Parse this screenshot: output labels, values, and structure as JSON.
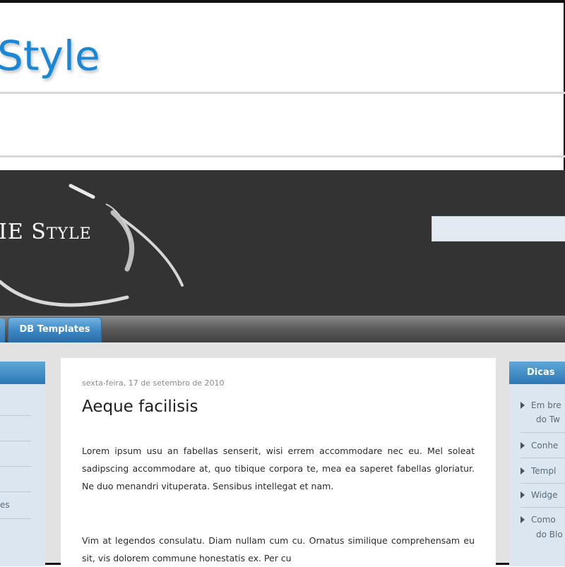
{
  "header": {
    "site_title": "Style"
  },
  "banner": {
    "title_main": "E S",
    "title_small_a": "",
    "title_tail": "TYLE"
  },
  "nav": {
    "tabs": [
      {
        "label": "DB Templates"
      }
    ]
  },
  "left_sidebar": {
    "partial_text": "es"
  },
  "post": {
    "date": "sexta-feira, 17 de setembro de 2010",
    "title": "Aeque facilisis",
    "paragraph1": "Lorem ipsum usu an fabellas senserit, wisi errem accommodare nec eu. Mel soleat sadipscing accommodare at, quo tibique corpora te, mea ea saperet fabellas gloriatur. Ne duo menandri vituperata. Sensibus intellegat et nam.",
    "paragraph2": "Vim at legendos consulatu. Diam nullam cum cu. Ornatus similique comprehensam eu sit, vis dolorem commune honestatis ex. Per cu"
  },
  "right_sidebar": {
    "heading": "Dicas",
    "items": [
      {
        "label": "Em bre",
        "sub": "do Tw"
      },
      {
        "label": "Conhe"
      },
      {
        "label": "Templ"
      },
      {
        "label": "Widge"
      },
      {
        "label": "Como",
        "sub": "do Blo"
      }
    ]
  },
  "colors": {
    "accent_blue": "#1a87d6",
    "banner_bg": "#333333",
    "tab_blue": "#3a86c4"
  }
}
